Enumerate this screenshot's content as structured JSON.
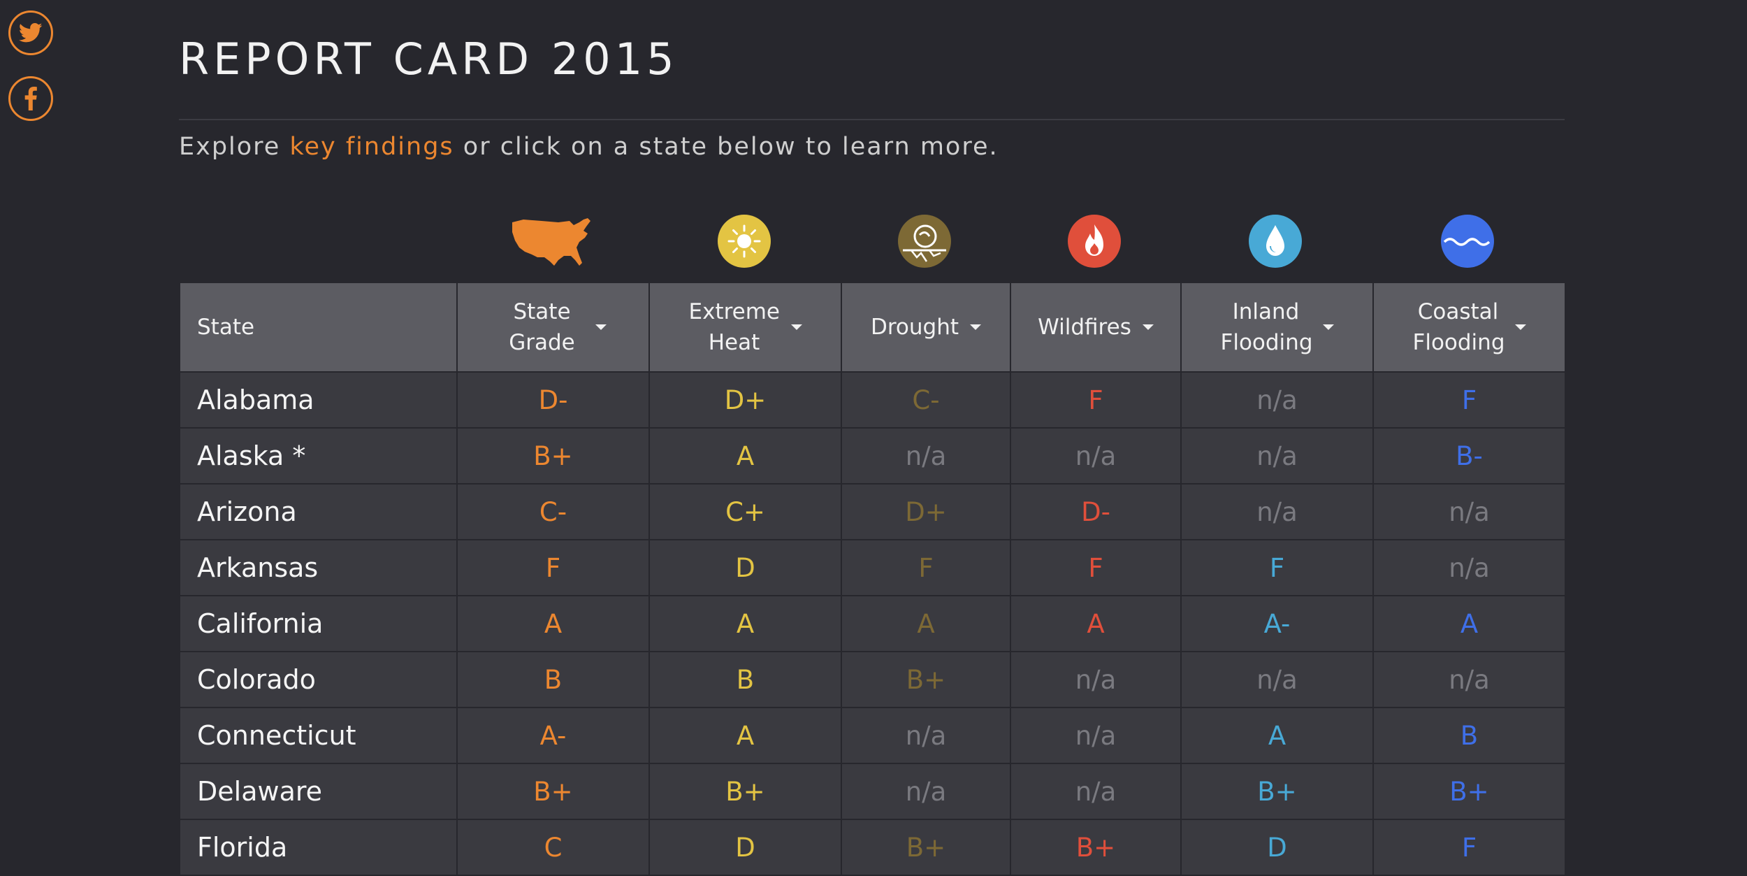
{
  "title": "REPORT CARD 2015",
  "intro": {
    "before": "Explore ",
    "link": "key findings",
    "after": " or click on a state below to learn more."
  },
  "social": [
    {
      "name": "twitter-button",
      "icon": "twitter-icon"
    },
    {
      "name": "facebook-button",
      "icon": "facebook-icon"
    }
  ],
  "colors": {
    "background": "#27272d",
    "header": "#5c5c62",
    "cell": "#3a3a40",
    "state_grade": "#ec8730",
    "extreme_heat": "#e3c443",
    "drought": "#7d6935",
    "wildfires": "#e04f3b",
    "inland_flooding": "#48a9d6",
    "coastal_flooding": "#3f6fe8",
    "na": "#7a7a80"
  },
  "columns": [
    {
      "key": "state",
      "label": "State",
      "icon": null
    },
    {
      "key": "state_grade",
      "label": "State Grade",
      "icon": "usa-map-icon"
    },
    {
      "key": "extreme_heat",
      "label": "Extreme Heat",
      "icon": "sun-icon"
    },
    {
      "key": "drought",
      "label": "Drought",
      "icon": "drought-icon"
    },
    {
      "key": "wildfires",
      "label": "Wildfires",
      "icon": "flame-icon"
    },
    {
      "key": "inland_flooding",
      "label": "Inland Flooding",
      "icon": "water-drop-icon"
    },
    {
      "key": "coastal_flooding",
      "label": "Coastal Flooding",
      "icon": "waves-icon"
    }
  ],
  "rows": [
    {
      "state": "Alabama",
      "state_grade": "D-",
      "extreme_heat": "D+",
      "drought": "C-",
      "wildfires": "F",
      "inland_flooding": "n/a",
      "coastal_flooding": "F"
    },
    {
      "state": "Alaska *",
      "state_grade": "B+",
      "extreme_heat": "A",
      "drought": "n/a",
      "wildfires": "n/a",
      "inland_flooding": "n/a",
      "coastal_flooding": "B-"
    },
    {
      "state": "Arizona",
      "state_grade": "C-",
      "extreme_heat": "C+",
      "drought": "D+",
      "wildfires": "D-",
      "inland_flooding": "n/a",
      "coastal_flooding": "n/a"
    },
    {
      "state": "Arkansas",
      "state_grade": "F",
      "extreme_heat": "D",
      "drought": "F",
      "wildfires": "F",
      "inland_flooding": "F",
      "coastal_flooding": "n/a"
    },
    {
      "state": "California",
      "state_grade": "A",
      "extreme_heat": "A",
      "drought": "A",
      "wildfires": "A",
      "inland_flooding": "A-",
      "coastal_flooding": "A"
    },
    {
      "state": "Colorado",
      "state_grade": "B",
      "extreme_heat": "B",
      "drought": "B+",
      "wildfires": "n/a",
      "inland_flooding": "n/a",
      "coastal_flooding": "n/a"
    },
    {
      "state": "Connecticut",
      "state_grade": "A-",
      "extreme_heat": "A",
      "drought": "n/a",
      "wildfires": "n/a",
      "inland_flooding": "A",
      "coastal_flooding": "B"
    },
    {
      "state": "Delaware",
      "state_grade": "B+",
      "extreme_heat": "B+",
      "drought": "n/a",
      "wildfires": "n/a",
      "inland_flooding": "B+",
      "coastal_flooding": "B+"
    },
    {
      "state": "Florida",
      "state_grade": "C",
      "extreme_heat": "D",
      "drought": "B+",
      "wildfires": "B+",
      "inland_flooding": "D",
      "coastal_flooding": "F"
    }
  ]
}
